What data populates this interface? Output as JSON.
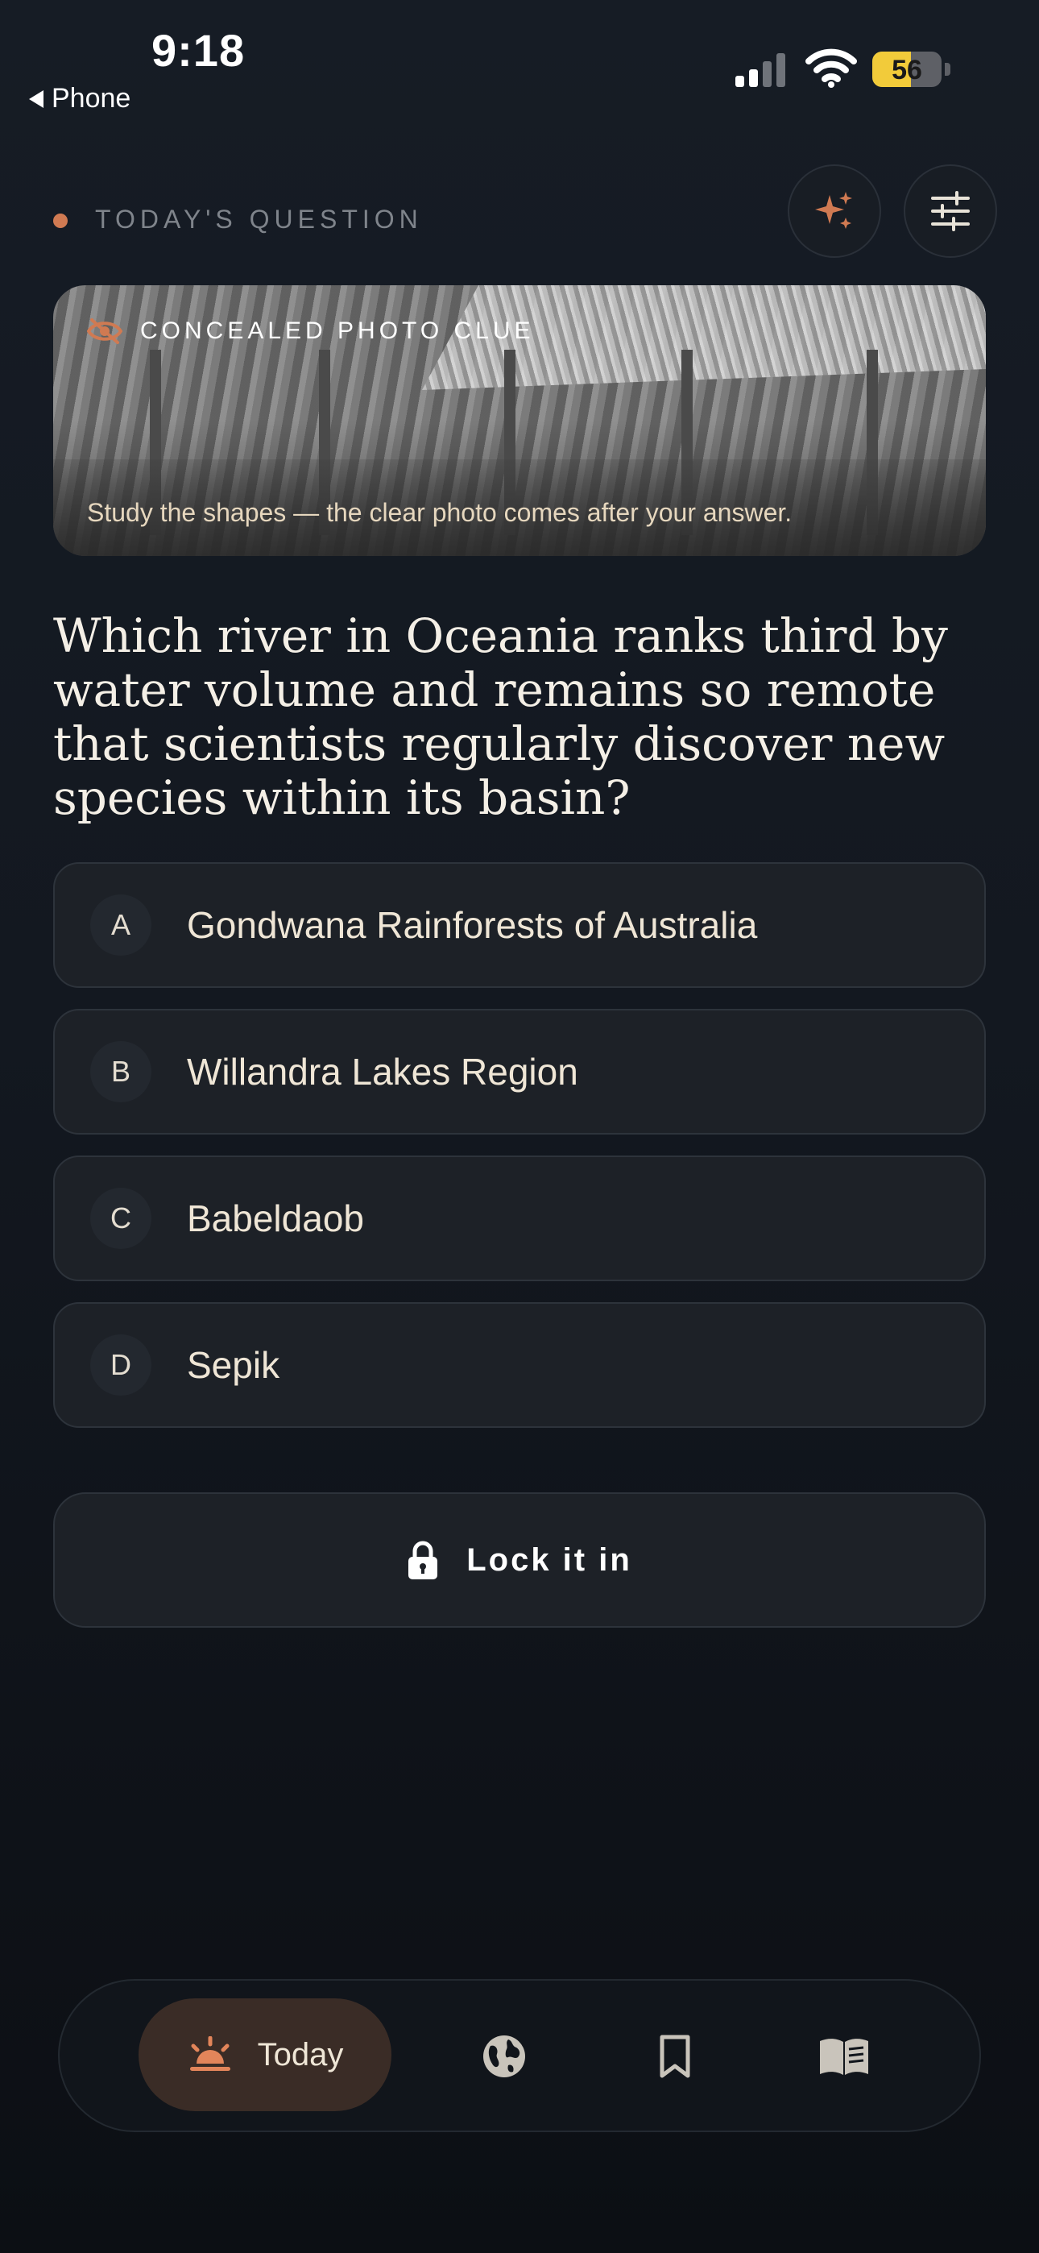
{
  "status_bar": {
    "time": "9:18",
    "back_label": "Phone",
    "battery": "56"
  },
  "header": {
    "section_label": "TODAY'S QUESTION"
  },
  "photo_clue": {
    "title": "CONCEALED PHOTO CLUE",
    "subtitle": "Study the shapes — the clear photo comes after your answer."
  },
  "question": "Which river in Oceania ranks third by water volume and remains so remote that scientists regularly discover new species within its basin?",
  "options": [
    {
      "letter": "A",
      "text": "Gondwana Rainforests of Australia"
    },
    {
      "letter": "B",
      "text": "Willandra Lakes Region"
    },
    {
      "letter": "C",
      "text": "Babeldaob"
    },
    {
      "letter": "D",
      "text": "Sepik"
    }
  ],
  "submit": {
    "label": "Lock it in",
    "icon": "lock-icon"
  },
  "tabs": [
    {
      "label": "Today",
      "icon": "sunrise-icon",
      "active": true
    },
    {
      "label": "",
      "icon": "globe-icon"
    },
    {
      "label": "",
      "icon": "bookmark-icon"
    },
    {
      "label": "",
      "icon": "journal-icon"
    }
  ],
  "colors": {
    "accent": "#d07a52",
    "background": "#131820",
    "card": "#1d2127",
    "text": "#efe6d6"
  }
}
